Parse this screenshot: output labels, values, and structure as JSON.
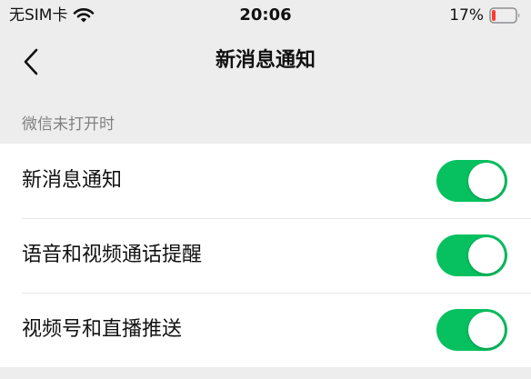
{
  "status_bar": {
    "carrier": "无SIM卡",
    "time": "20:06",
    "battery_percent": "17%",
    "icons": [
      "wifi-icon",
      "battery-icon"
    ],
    "battery_level": 0.17,
    "battery_color": "#ff3b30"
  },
  "nav": {
    "title": "新消息通知",
    "back_icon": "chevron-left-icon"
  },
  "section": {
    "header": "微信未打开时"
  },
  "settings": [
    {
      "label": "新消息通知",
      "enabled": true
    },
    {
      "label": "语音和视频通话提醒",
      "enabled": true
    },
    {
      "label": "视频号和直播推送",
      "enabled": true
    }
  ],
  "colors": {
    "toggle_on": "#07c160",
    "background": "#ededed",
    "section_text": "#808080"
  }
}
